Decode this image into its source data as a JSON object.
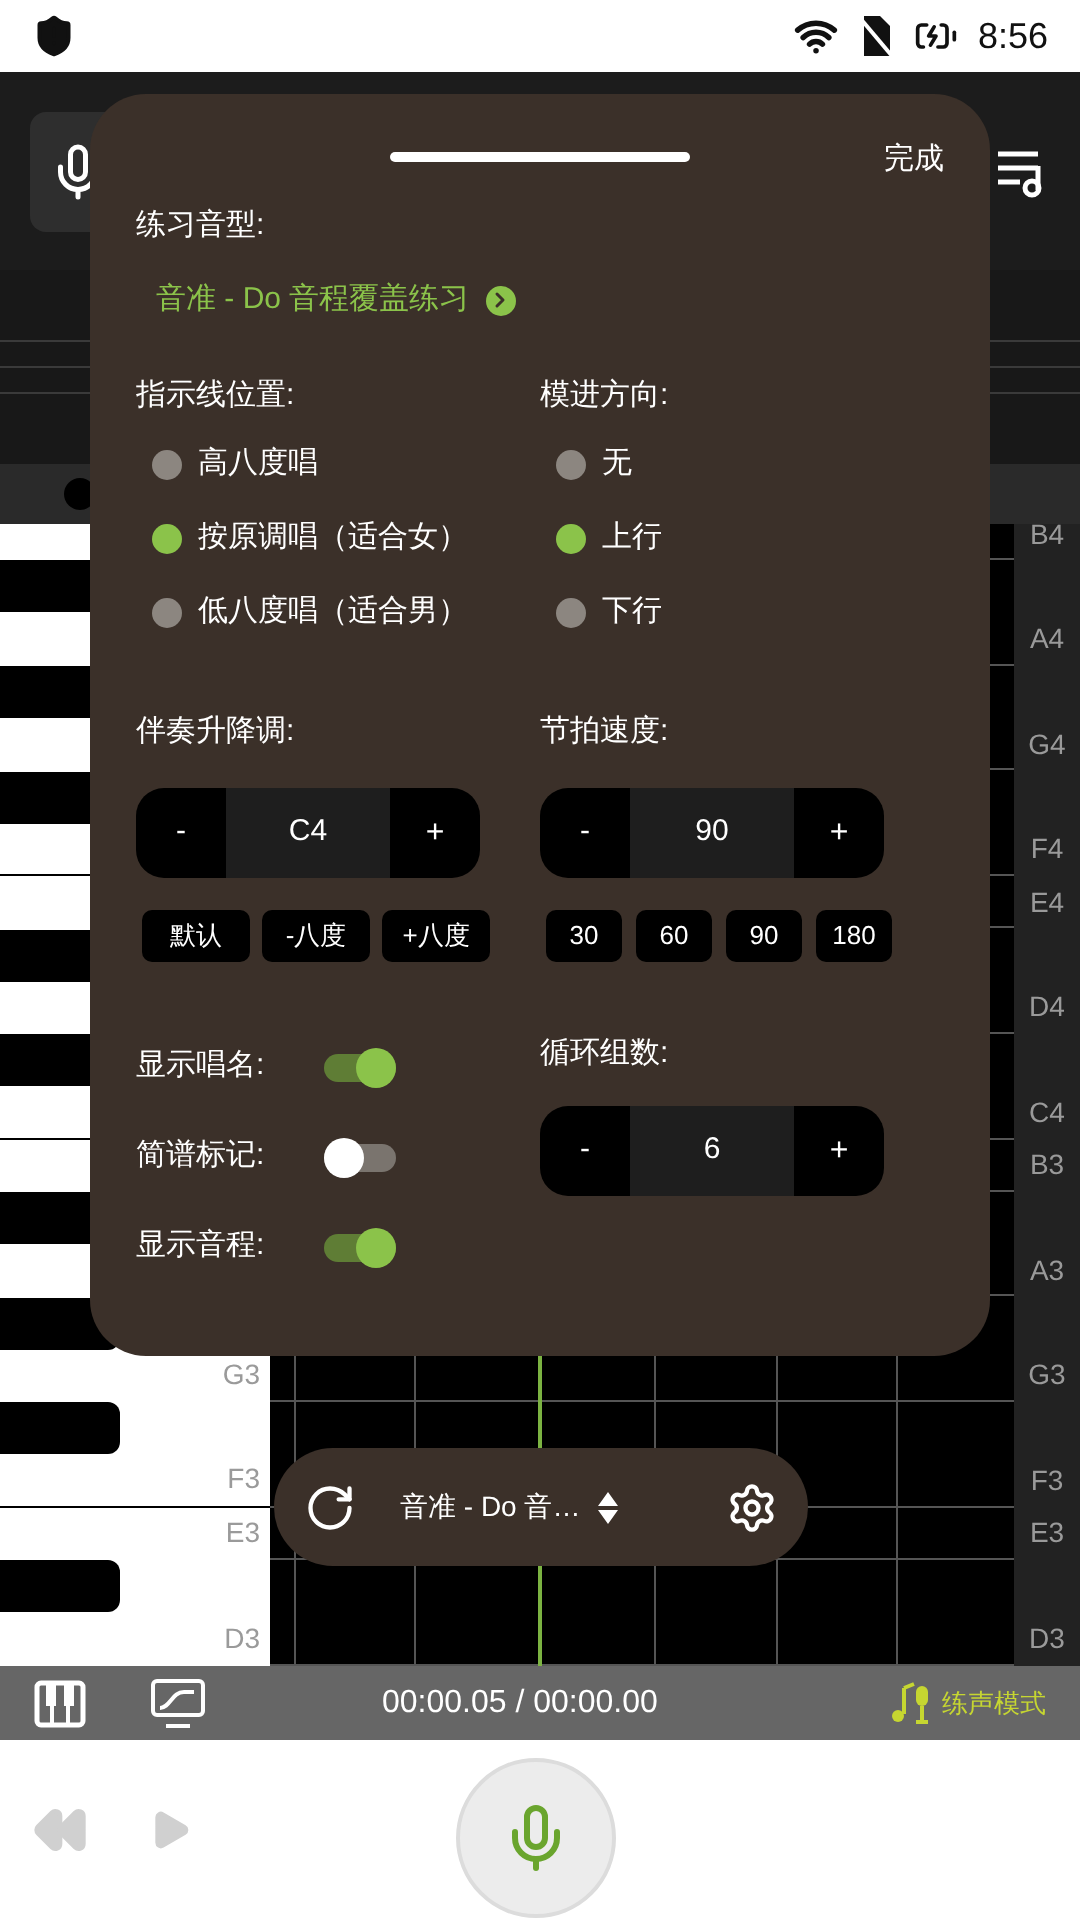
{
  "status_bar": {
    "time": "8:56"
  },
  "panel": {
    "done": "完成",
    "pattern_label": "练习音型:",
    "pattern_value": "音准 - Do 音程覆盖练习",
    "guide": {
      "label": "指示线位置:",
      "options": [
        {
          "label": "高八度唱",
          "selected": false
        },
        {
          "label": "按原调唱（适合女）",
          "selected": true
        },
        {
          "label": "低八度唱（适合男）",
          "selected": false
        }
      ]
    },
    "direction": {
      "label": "模进方向:",
      "options": [
        {
          "label": "无",
          "selected": false
        },
        {
          "label": "上行",
          "selected": true
        },
        {
          "label": "下行",
          "selected": false
        }
      ]
    },
    "transpose": {
      "label": "伴奏升降调:",
      "minus": "-",
      "value": "C4",
      "plus": "+",
      "presets": [
        "默认",
        "-八度",
        "+八度"
      ]
    },
    "tempo": {
      "label": "节拍速度:",
      "minus": "-",
      "value": "90",
      "plus": "+",
      "presets": [
        "30",
        "60",
        "90",
        "180"
      ]
    },
    "toggles": [
      {
        "label": "显示唱名:",
        "on": true
      },
      {
        "label": "简谱标记:",
        "on": false
      },
      {
        "label": "显示音程:",
        "on": true
      }
    ],
    "loops": {
      "label": "循环组数:",
      "minus": "-",
      "value": "6",
      "plus": "+"
    }
  },
  "rows": [
    {
      "kind": "white",
      "label": "B4"
    },
    {
      "kind": "black"
    },
    {
      "kind": "white",
      "label": "A4"
    },
    {
      "kind": "black"
    },
    {
      "kind": "white",
      "label": "G4"
    },
    {
      "kind": "black"
    },
    {
      "kind": "white",
      "label": "F4"
    },
    {
      "kind": "white",
      "label": "E4"
    },
    {
      "kind": "black"
    },
    {
      "kind": "white",
      "label": "D4"
    },
    {
      "kind": "black"
    },
    {
      "kind": "white",
      "label": "C4"
    },
    {
      "kind": "white",
      "label": "B3"
    },
    {
      "kind": "black"
    },
    {
      "kind": "white",
      "label": "A3"
    },
    {
      "kind": "black"
    },
    {
      "kind": "white",
      "label": "G3",
      "key_label": "G3"
    },
    {
      "kind": "black"
    },
    {
      "kind": "white",
      "label": "F3",
      "key_label": "F3"
    },
    {
      "kind": "white",
      "label": "E3",
      "key_label": "E3"
    },
    {
      "kind": "black"
    },
    {
      "kind": "white",
      "label": "D3",
      "key_label": "D3"
    }
  ],
  "pill": {
    "pattern": "音准 - Do 音…"
  },
  "bottom_bar": {
    "time": "00:00.05 / 00:00.00",
    "mode": "练声模式"
  }
}
